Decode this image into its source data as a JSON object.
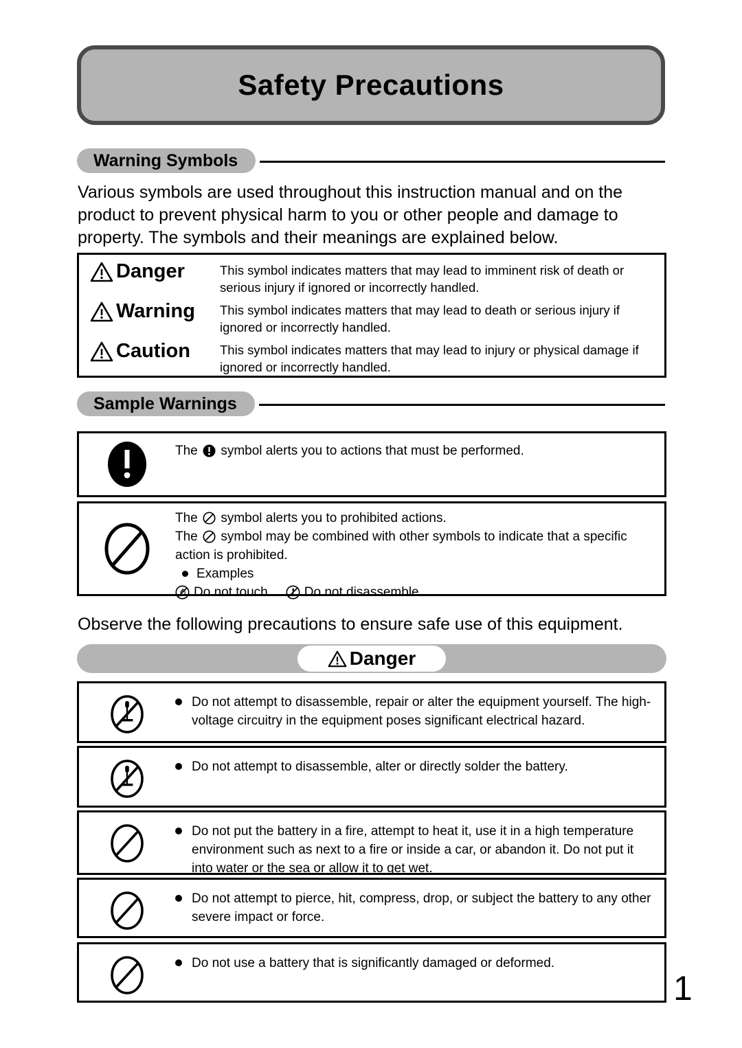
{
  "document": {
    "title": "Safety Precautions",
    "page_number": "1"
  },
  "sections": {
    "warning_symbols": {
      "heading": "Warning Symbols",
      "intro": "Various symbols are used throughout this instruction manual and on the product to prevent physical harm to you or other people and damage to property. The symbols and their meanings are explained below.",
      "rows": [
        {
          "icon": "warning-triangle-icon",
          "label": "Danger",
          "description": "This symbol indicates matters that may lead to imminent risk of death or serious injury if ignored or incorrectly handled."
        },
        {
          "icon": "warning-triangle-icon",
          "label": "Warning",
          "description": "This symbol indicates matters that may lead to death or serious injury if ignored or incorrectly handled."
        },
        {
          "icon": "warning-triangle-icon",
          "label": "Caution",
          "description": "This symbol indicates matters that may lead to injury or physical damage if ignored or incorrectly handled."
        }
      ]
    },
    "sample_warnings": {
      "heading": "Sample Warnings",
      "mandatory": {
        "icon": "mandatory-action-icon",
        "text_before": "The",
        "inline_icon": "mandatory-action-icon",
        "text_after": "symbol alerts you to actions that must be performed."
      },
      "prohibition": {
        "icon": "prohibition-icon",
        "line1_before": "The",
        "line1_after": "symbol alerts you to prohibited actions.",
        "line2_before": "The",
        "line2_after": "symbol may be combined with other symbols to indicate that a specific action is prohibited.",
        "examples_label": "Examples",
        "examples": [
          {
            "icon": "do-not-touch-icon",
            "label": "Do not touch"
          },
          {
            "icon": "do-not-disassemble-icon",
            "label": "Do not disassemble"
          }
        ]
      }
    },
    "danger_section": {
      "intro": "Observe the following precautions to ensure safe use of this equipment.",
      "banner_label": "Danger",
      "banner_icon": "warning-triangle-icon",
      "items": [
        {
          "icon": "do-not-disassemble-icon",
          "text": "Do not attempt to disassemble, repair or alter the equipment yourself. The high-voltage circuitry in the equipment poses significant electrical hazard."
        },
        {
          "icon": "do-not-disassemble-icon",
          "text": "Do not attempt to disassemble, alter or directly solder the battery."
        },
        {
          "icon": "prohibition-icon",
          "text": "Do not put the battery in a fire, attempt to heat it, use it in a high temperature environment such as next to a fire or inside a car, or abandon it. Do not put it into water or the sea or allow it to get wet."
        },
        {
          "icon": "prohibition-icon",
          "text": "Do not attempt to pierce, hit, compress, drop, or subject the battery to any other severe impact or force."
        },
        {
          "icon": "prohibition-icon",
          "text": "Do not use a battery that is significantly damaged or deformed."
        }
      ]
    }
  },
  "colors": {
    "banner_gray": "#b4b4b4",
    "banner_border": "#4a4a4a",
    "ink": "#000000",
    "paper": "#ffffff"
  }
}
